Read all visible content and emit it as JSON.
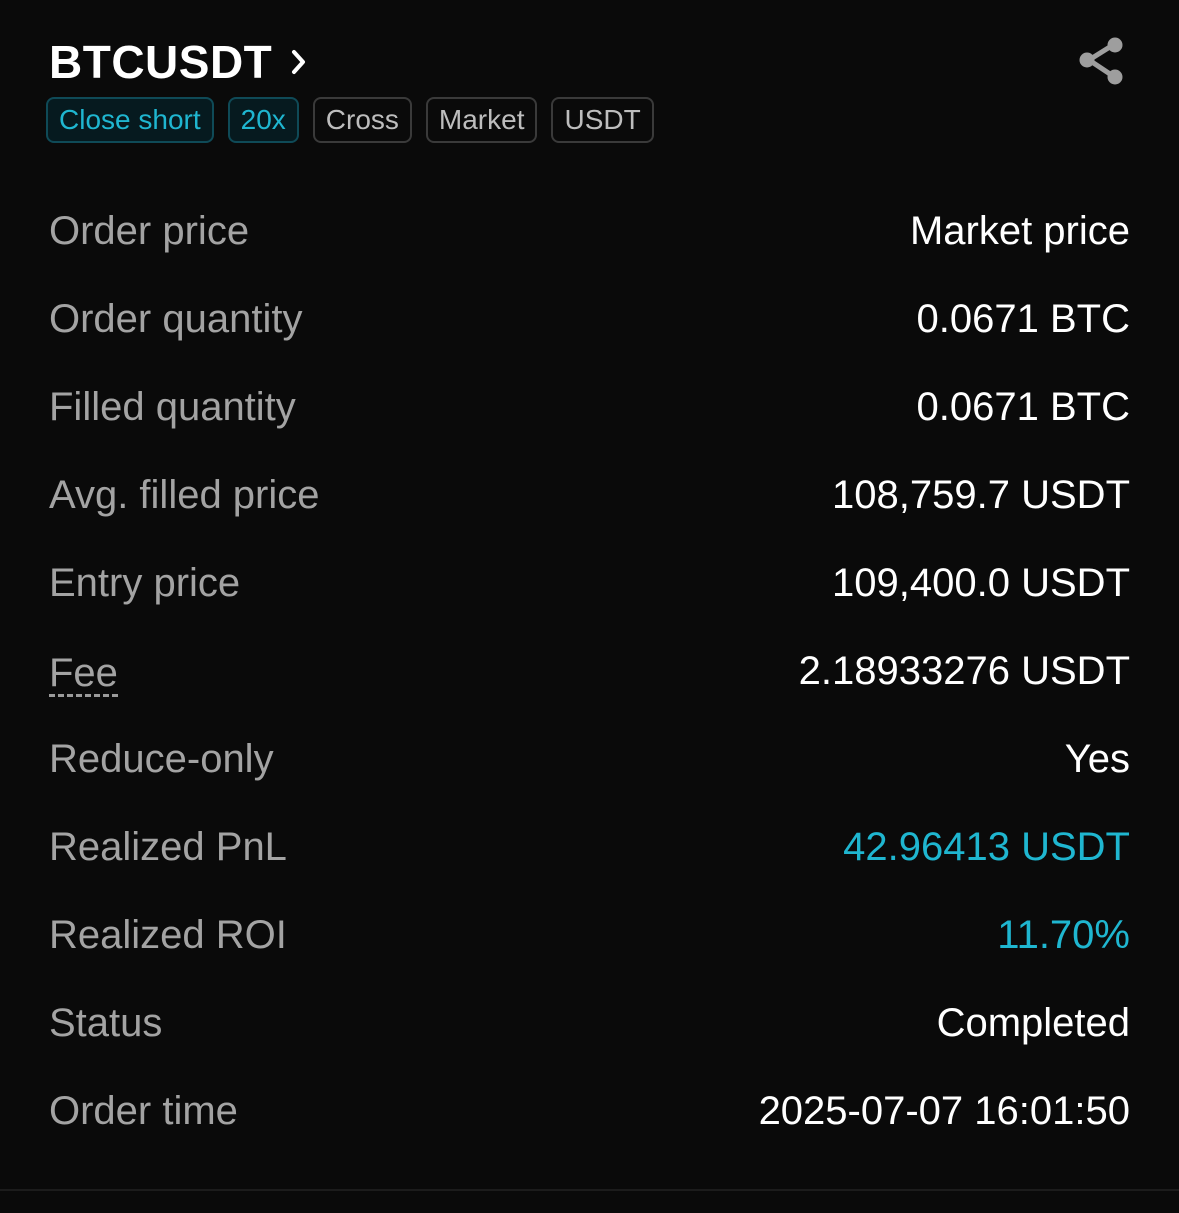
{
  "header": {
    "symbol": "BTCUSDT"
  },
  "tags": [
    {
      "label": "Close short",
      "accent": true
    },
    {
      "label": "20x",
      "accent": true
    },
    {
      "label": "Cross",
      "accent": false
    },
    {
      "label": "Market",
      "accent": false
    },
    {
      "label": "USDT",
      "accent": false
    }
  ],
  "rows": [
    {
      "label": "Order price",
      "value": "Market price"
    },
    {
      "label": "Order quantity",
      "value": "0.0671 BTC"
    },
    {
      "label": "Filled quantity",
      "value": "0.0671 BTC"
    },
    {
      "label": "Avg. filled price",
      "value": "108,759.7 USDT"
    },
    {
      "label": "Entry price",
      "value": "109,400.0 USDT"
    },
    {
      "label": "Fee",
      "value": "2.18933276 USDT"
    },
    {
      "label": "Reduce-only",
      "value": "Yes"
    },
    {
      "label": "Realized PnL",
      "value": "42.96413 USDT"
    },
    {
      "label": "Realized ROI",
      "value": "11.70%"
    },
    {
      "label": "Status",
      "value": "Completed"
    },
    {
      "label": "Order time",
      "value": "2025-07-07 16:01:50"
    }
  ],
  "colors": {
    "background": "#0a0a0a",
    "accent": "#1fb6d0",
    "label": "#a3a3a3",
    "value": "#ffffff"
  },
  "icons": {
    "chevron": "chevron-right-icon",
    "share": "share-icon"
  }
}
